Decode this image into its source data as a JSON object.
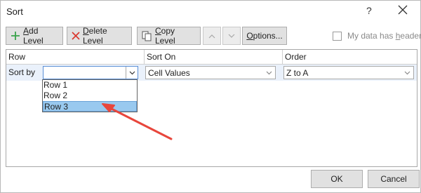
{
  "window": {
    "title": "Sort",
    "help_glyph": "?"
  },
  "toolbar": {
    "add_level": {
      "accel": "A",
      "rest": "dd Level"
    },
    "delete_level": {
      "accel": "D",
      "rest": "elete Level"
    },
    "copy_level": {
      "accel": "C",
      "rest": "opy Level"
    },
    "options": {
      "accel": "O",
      "rest": "ptions..."
    },
    "my_data_has_headers": {
      "prefix": "My data has ",
      "accel": "h",
      "rest": "eaders"
    }
  },
  "grid": {
    "headers": {
      "column": "Row",
      "sort_on": "Sort On",
      "order": "Order"
    },
    "rows": [
      {
        "label": "Sort by",
        "column_value": "",
        "sort_on": "Cell Values",
        "order": "Z to A"
      }
    ]
  },
  "column_dropdown": {
    "options": [
      "Row 1",
      "Row 2",
      "Row 3"
    ],
    "highlighted": "Row 3"
  },
  "footer": {
    "ok": "OK",
    "cancel": "Cancel"
  },
  "colors": {
    "accent_arrow": "#e8463c",
    "selection": "#99c9ef",
    "row_highlight": "#eaf1fb"
  }
}
